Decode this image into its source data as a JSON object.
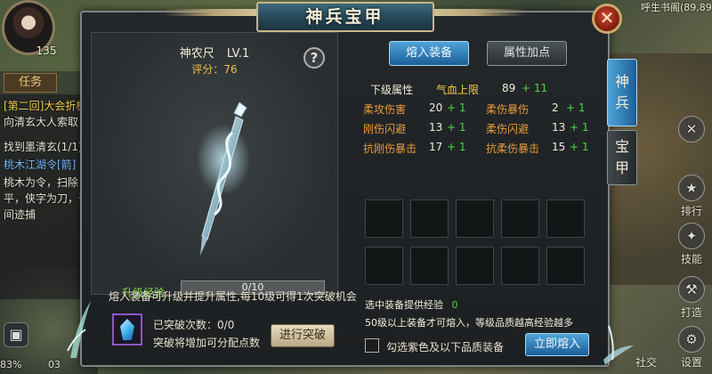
{
  "title": "神兵宝甲",
  "close_icon": "close-icon",
  "hud": {
    "player_level": "135",
    "quest_tab": "任务",
    "quest_lines": [
      {
        "text": "[第二回]大会折梗",
        "color": "#f2d046"
      },
      {
        "text": "向清玄大人索取",
        "color": "#e9e2d4"
      },
      {
        "text": "找到墨清玄(1/1)",
        "color": "#e9e2d4"
      },
      {
        "text": "桃木江湖令[箭]",
        "color": "#7ab8ff"
      },
      {
        "text": "桃木为令，扫除",
        "color": "#e9e2d4"
      },
      {
        "text": "平，侠字为刀，于",
        "color": "#e9e2d4"
      },
      {
        "text": "间迹捕",
        "color": "#e9e2d4"
      }
    ],
    "map_coords": "呼生书阁(89,89)",
    "status": "83%",
    "status_time": "03",
    "right_buttons": [
      {
        "label": "排行",
        "icon": "ranking-icon",
        "glyph": "★"
      },
      {
        "label": "技能",
        "icon": "skill-icon",
        "glyph": "✦"
      },
      {
        "label": "打造",
        "icon": "forge-icon",
        "glyph": "⚒"
      },
      {
        "label": "设置",
        "icon": "settings-icon",
        "glyph": "⚙"
      }
    ],
    "social_label": "社交"
  },
  "item": {
    "name": "神农尺",
    "level": "LV.1",
    "score_label": "评分：",
    "score": "76",
    "help_glyph": "?"
  },
  "upgrade": {
    "exp_label": "升级经验",
    "exp_current": 0,
    "exp_max": 10,
    "exp_text": "0/10",
    "hint": "熔入装备可升级并提升属性,每10级可得1次突破机会",
    "break_count_label": "已突破次数：",
    "break_count": "0/0",
    "break_hint": "突破将增加可分配点数",
    "break_button": "进行突破"
  },
  "tabs": {
    "smelt_equip": "熔入装备",
    "attr_points": "属性加点"
  },
  "stats": {
    "next_level_label": "下级属性",
    "hp_label": "气血上限",
    "hp_value": "89",
    "hp_up": "+ 11",
    "rows": [
      [
        {
          "name": "柔攻伤害",
          "value": "20",
          "up": "+ 1"
        },
        {
          "name": "柔伤暴伤",
          "value": "2",
          "up": "+ 1"
        }
      ],
      [
        {
          "name": "刚伤闪避",
          "value": "13",
          "up": "+ 1"
        },
        {
          "name": "柔伤闪避",
          "value": "13",
          "up": "+ 1"
        }
      ],
      [
        {
          "name": "抗刚伤暴击",
          "value": "17",
          "up": "+ 1"
        },
        {
          "name": "抗柔伤暴击",
          "value": "15",
          "up": "+ 1"
        }
      ]
    ]
  },
  "slots": 10,
  "footer": {
    "provide_label": "选中装备提供经验",
    "provide_value": "0",
    "rule_hint": "50级以上装备才可熔入，等级品质越高经验越多",
    "checkbox_label": "勾选紫色及以下品质装备",
    "smelt_button": "立即熔入"
  },
  "side_tabs": {
    "weapon": [
      "神",
      "兵"
    ],
    "armor": [
      "宝",
      "甲"
    ]
  },
  "colors": {
    "accent_blue": "#1c5e98",
    "exp_green": "#8ee04a",
    "gain_green": "#4ad84a",
    "score_gold": "#f0c04a",
    "attr_orange": "#e89a3c",
    "hp_yellow": "#f2d046"
  }
}
